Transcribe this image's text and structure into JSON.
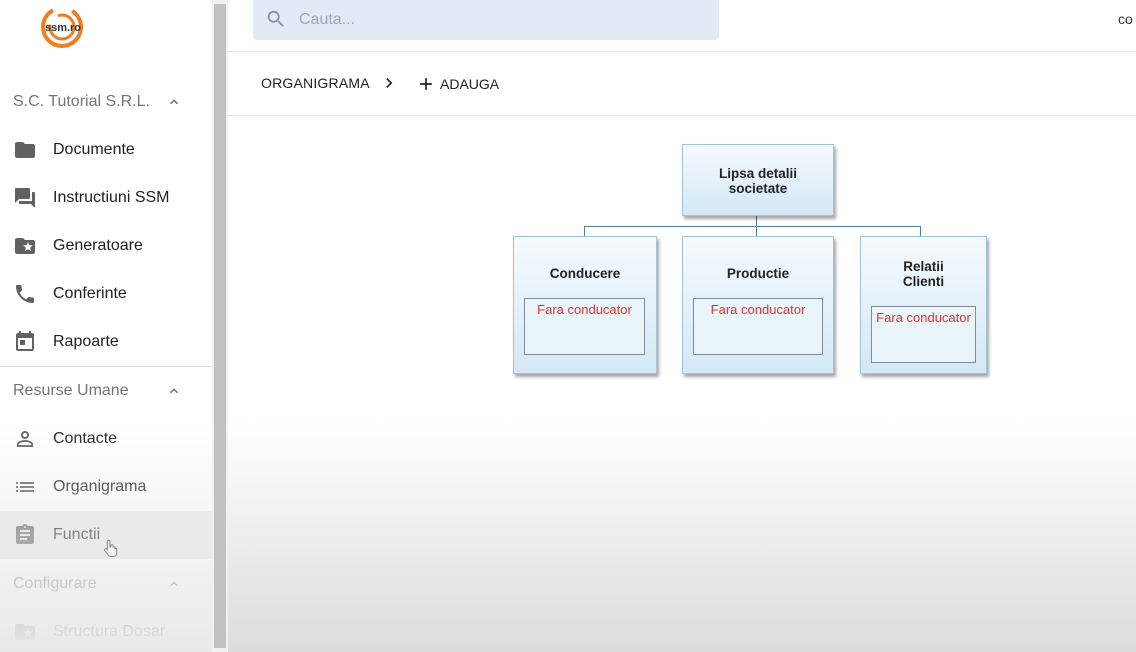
{
  "logo": {
    "text": "ssm.ro"
  },
  "sidebar": {
    "sections": [
      {
        "title": "S.C. Tutorial S.R.L.",
        "items": [
          {
            "label": "Documente",
            "icon": "folder-icon"
          },
          {
            "label": "Instructiuni SSM",
            "icon": "forum-icon"
          },
          {
            "label": "Generatoare",
            "icon": "folder-star-icon"
          },
          {
            "label": "Conferinte",
            "icon": "phone-icon"
          },
          {
            "label": "Rapoarte",
            "icon": "calendar-icon"
          }
        ]
      },
      {
        "title": "Resurse Umane",
        "items": [
          {
            "label": "Contacte",
            "icon": "person-icon"
          },
          {
            "label": "Organigrama",
            "icon": "list-icon"
          },
          {
            "label": "Functii",
            "icon": "clipboard-icon",
            "active": true
          }
        ]
      },
      {
        "title": "Configurare",
        "items": [
          {
            "label": "Structura Dosar",
            "icon": "folder-star-icon"
          }
        ]
      }
    ]
  },
  "search": {
    "placeholder": "Cauta..."
  },
  "topbar": {
    "right_text": "co"
  },
  "toolbar": {
    "breadcrumb": "ORGANIGRAMA",
    "add_label": "ADAUGA"
  },
  "orgchart": {
    "root": {
      "title": "Lipsa detalii societate"
    },
    "children": [
      {
        "title": "Conducere",
        "leader": "Fara conducator"
      },
      {
        "title": "Productie",
        "leader": "Fara conducator"
      },
      {
        "title": "Relatii Clienti",
        "leader": "Fara conducator"
      }
    ]
  },
  "colors": {
    "accent_orange": "#f07d22",
    "leader_red": "#e0352b",
    "search_bg": "#e3eaf6"
  }
}
